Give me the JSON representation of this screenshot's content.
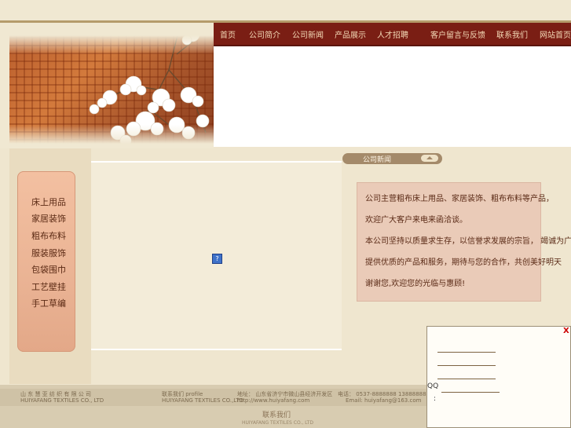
{
  "nav": {
    "items": [
      "首页",
      "公司简介",
      "公司新闻",
      "产品展示",
      "人才招聘",
      "客户留言与反馈",
      "联系我们",
      "网站首页"
    ]
  },
  "sidebar": {
    "items": [
      "床上用品",
      "家居装饰",
      "粗布布料",
      "服装服饰",
      "包袋围巾",
      "工艺壁挂",
      "手工草编"
    ]
  },
  "help_icon_glyph": "?",
  "news": {
    "title": "公司新闻",
    "lines": [
      "公司主营粗布床上用品、家居装饰、粗布布料等产品，",
      "欢迎广大客户来电来函洽谈。",
      "本公司坚持以质量求生存，以信誉求发展的宗旨， 竭诚为广大客户",
      "提供优质的产品和服务，期待与您的合作，共创美好明天",
      "谢谢您,欢迎您的光临与惠顾!"
    ]
  },
  "footer": {
    "company_cn": "山 东 慧 亚 纺 织 有 限 公 司",
    "company_en": "HUIYAFANG TEXTILES CO., LTD",
    "contact_label": "联系我们 profile",
    "contact_label_en": "HUIYAFANG TEXTILES CO.,LTD",
    "address": "地址：  山东省济宁市微山县经济开发区",
    "website": "http://www.huiyafang.com",
    "phone": "电话：  0537-8888888  13888888888",
    "email": "Email: huiyafang@163.com",
    "contact_link": "联系我们",
    "contact_sub": "HUIYAFANG TEXTILES CO., LTD"
  },
  "popup": {
    "close": "X",
    "qq_label": "QQ",
    "colon": ":"
  },
  "colors": {
    "nav_bg": "#7a1e14",
    "page_bg": "#efe6cf",
    "side_menu_bg": "#eab394",
    "news_panel_bg": "#eacbb8"
  }
}
